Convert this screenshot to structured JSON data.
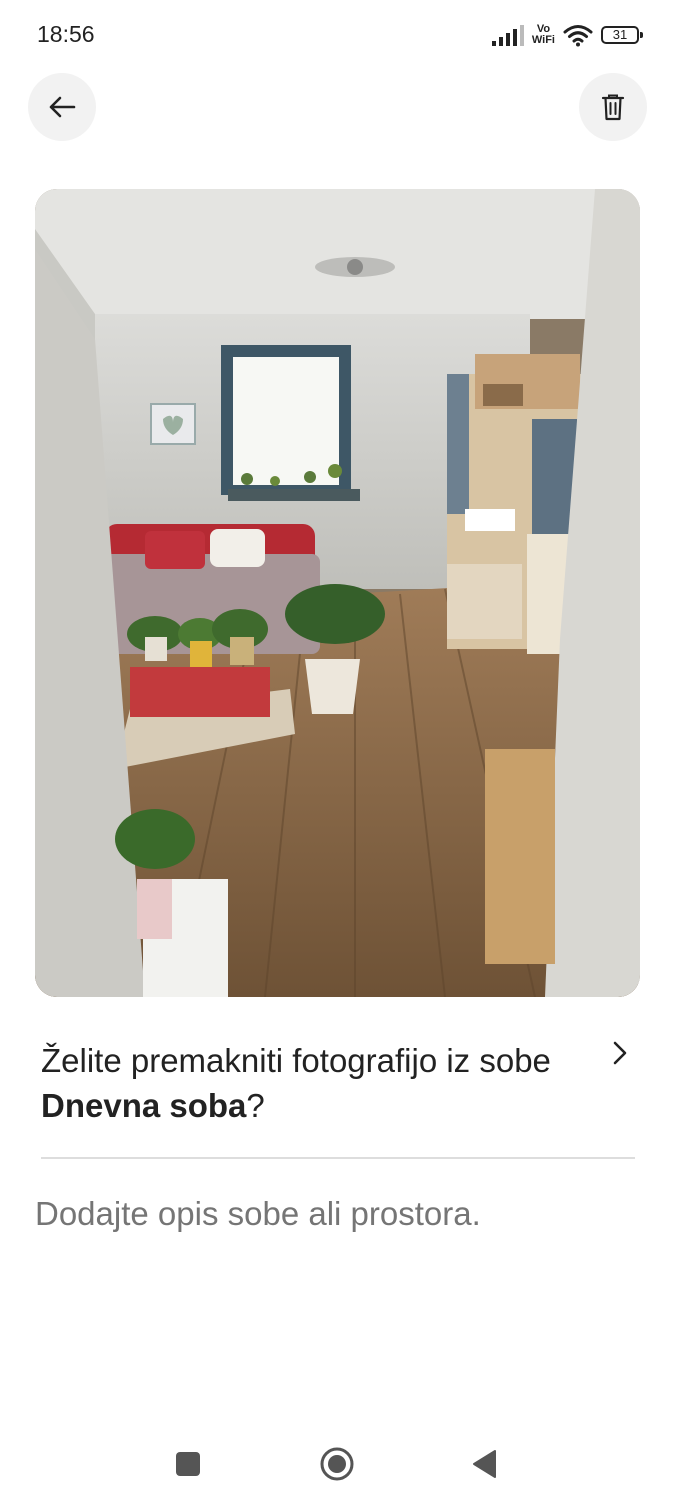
{
  "status_bar": {
    "time": "18:56",
    "volte_top": "Vo",
    "volte_bottom": "WiFi",
    "battery": "31"
  },
  "header": {
    "back_icon": "arrow-left-icon",
    "delete_icon": "trash-icon"
  },
  "photo": {
    "subject": "living-room-photo"
  },
  "move_prompt": {
    "text_before": "Želite premakniti fotografijo iz sobe ",
    "room_name": "Dnevna soba",
    "text_after": "?",
    "icon": "chevron-right-icon"
  },
  "description": {
    "placeholder": "Dodajte opis sobe ali prostora."
  },
  "nav_bar": {
    "recents_icon": "square-icon",
    "home_icon": "circle-icon",
    "back_icon": "triangle-back-icon"
  },
  "colors": {
    "text": "#222222",
    "placeholder": "#7a7a7a",
    "button_bg": "#f2f2f2",
    "divider": "#dddddd"
  }
}
